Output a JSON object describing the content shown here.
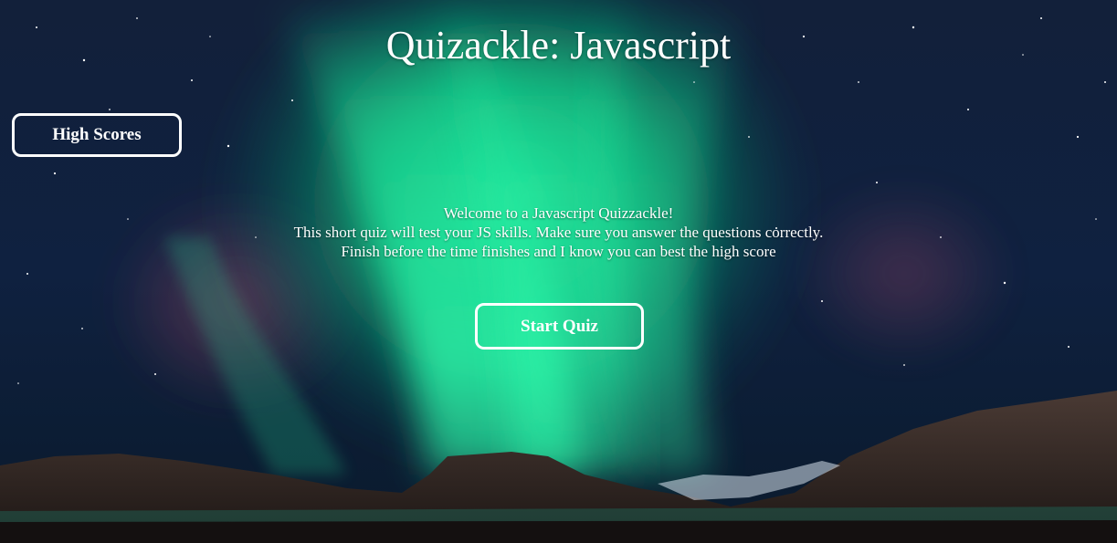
{
  "page": {
    "title": "Quizackle: Javascript"
  },
  "buttons": {
    "high_scores": "High Scores",
    "start_quiz": "Start Quiz"
  },
  "welcome": {
    "line1": "Welcome to a Javascript Quizzackle!",
    "line2": "This short quiz will test your JS skills. Make sure you answer the questions correctly.",
    "line3": "Finish before the time finishes and I know you can best the high score"
  },
  "colors": {
    "text": "#ffffff",
    "sky_dark": "#0a1424",
    "aurora_green": "#19e08c",
    "mountain": "#3a2a26"
  }
}
